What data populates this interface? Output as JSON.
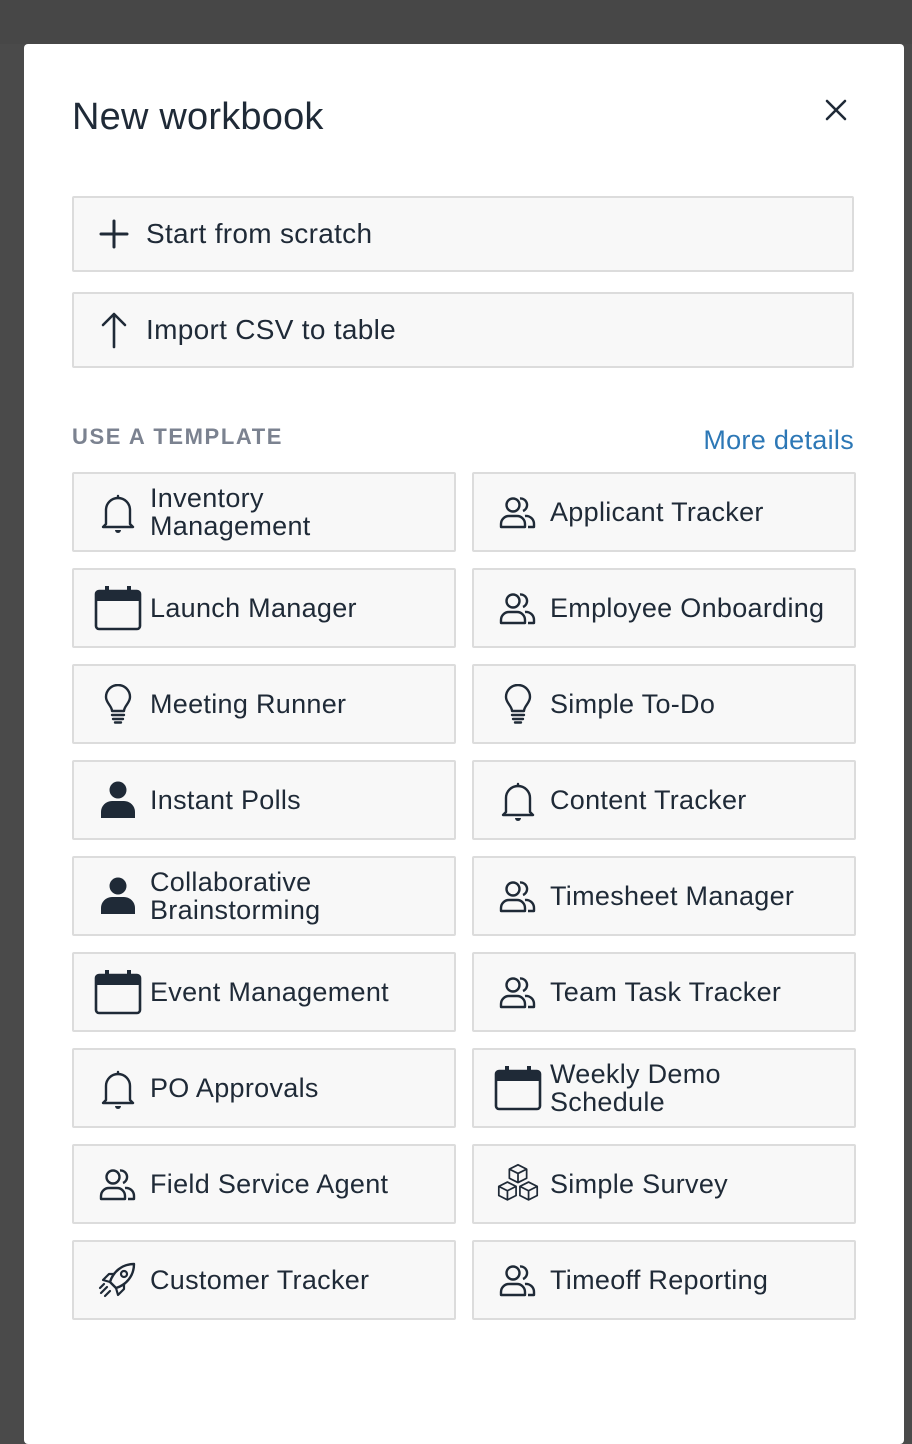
{
  "dialog": {
    "title": "New workbook",
    "close_icon": "close-icon"
  },
  "actions": [
    {
      "label": "Start from scratch",
      "icon": "plus-icon"
    },
    {
      "label": "Import CSV to table",
      "icon": "arrow-up-icon"
    }
  ],
  "templates_section": {
    "label": "USE A TEMPLATE",
    "more_link": "More details"
  },
  "templates": [
    {
      "label": "Inventory Management",
      "icon": "bell-icon"
    },
    {
      "label": "Applicant Tracker",
      "icon": "people-icon"
    },
    {
      "label": "Launch Manager",
      "icon": "calendar-icon"
    },
    {
      "label": "Employee Onboarding",
      "icon": "people-icon"
    },
    {
      "label": "Meeting Runner",
      "icon": "lightbulb-icon"
    },
    {
      "label": "Simple To-Do",
      "icon": "lightbulb-icon"
    },
    {
      "label": "Instant Polls",
      "icon": "person-icon"
    },
    {
      "label": "Content Tracker",
      "icon": "bell-icon"
    },
    {
      "label": "Collaborative Brainstorming",
      "icon": "person-icon"
    },
    {
      "label": "Timesheet Manager",
      "icon": "people-icon"
    },
    {
      "label": "Event Management",
      "icon": "calendar-icon"
    },
    {
      "label": "Team Task Tracker",
      "icon": "people-icon"
    },
    {
      "label": "PO Approvals",
      "icon": "bell-icon"
    },
    {
      "label": "Weekly Demo Schedule",
      "icon": "calendar-icon"
    },
    {
      "label": "Field Service Agent",
      "icon": "people-icon"
    },
    {
      "label": "Simple Survey",
      "icon": "cubes-icon"
    },
    {
      "label": "Customer Tracker",
      "icon": "rocket-icon"
    },
    {
      "label": "Timeoff Reporting",
      "icon": "people-icon"
    }
  ],
  "colors": {
    "link": "#2d78b6",
    "text": "#1f2a37",
    "section_label": "#7b8290",
    "tile_border": "#dcdcdc",
    "tile_bg": "#f8f8f8",
    "overlay": "#4a4a4a"
  }
}
